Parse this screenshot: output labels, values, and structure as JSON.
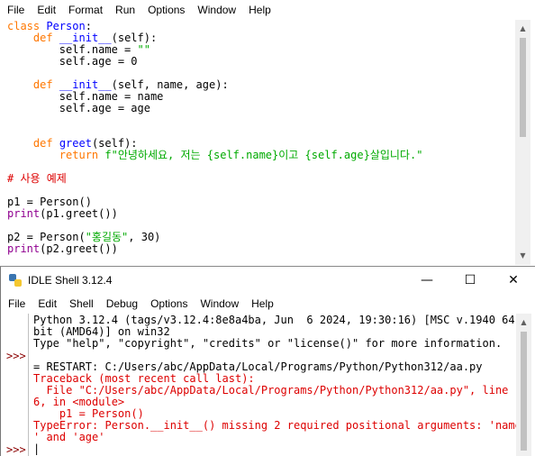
{
  "editor": {
    "menu": [
      "File",
      "Edit",
      "Format",
      "Run",
      "Options",
      "Window",
      "Help"
    ]
  },
  "shell": {
    "title": "IDLE Shell 3.12.4",
    "menu": [
      "File",
      "Edit",
      "Shell",
      "Debug",
      "Options",
      "Window",
      "Help"
    ],
    "prompt": ">>>",
    "banner_1": "Python 3.12.4 (tags/v3.12.4:8e8a4ba, Jun  6 2024, 19:30:16) [MSC v.1940 64",
    "banner_2": "bit (AMD64)] on win32",
    "banner_3": "Type \"help\", \"copyright\", \"credits\" or \"license()\" for more information.",
    "restart": "= RESTART: C:/Users/abc/AppData/Local/Programs/Python/Python312/aa.py",
    "tb_1": "Traceback (most recent call last):",
    "tb_2": "  File \"C:/Users/abc/AppData/Local/Programs/Python/Python312/aa.py\", line 1",
    "tb_3": "6, in <module>",
    "tb_4": "    p1 = Person()",
    "tb_5": "TypeError: Person.__init__() missing 2 required positional arguments: 'name",
    "tb_6": "' and 'age'"
  },
  "code": {
    "kw_class": "class",
    "cls_name": " Person",
    "colon": ":",
    "kw_def": "def",
    "init_name": "__init__",
    "init1_args": "(self):",
    "l3": "        self.name = ",
    "empty_str": "\"\"",
    "l4": "        self.age = 0",
    "init2_args": "(self, name, age):",
    "l7": "        self.name = name",
    "l8": "        self.age = age",
    "greet_name": "greet",
    "greet_args": "(self):",
    "kw_return": "return",
    "fstr": " f\"안녕하세요, 저는 {self.name}이고 {self.age}살입니다.\"",
    "comment": "# 사용 예제",
    "p1_assign": "p1 = Person()",
    "print": "print",
    "p1_print_rest": "(p1.greet())",
    "p2_assign": "p2 = Person(",
    "p2_str": "\"홍길동\"",
    "p2_rest": ", 30)",
    "p2_print_rest": "(p2.greet())"
  }
}
